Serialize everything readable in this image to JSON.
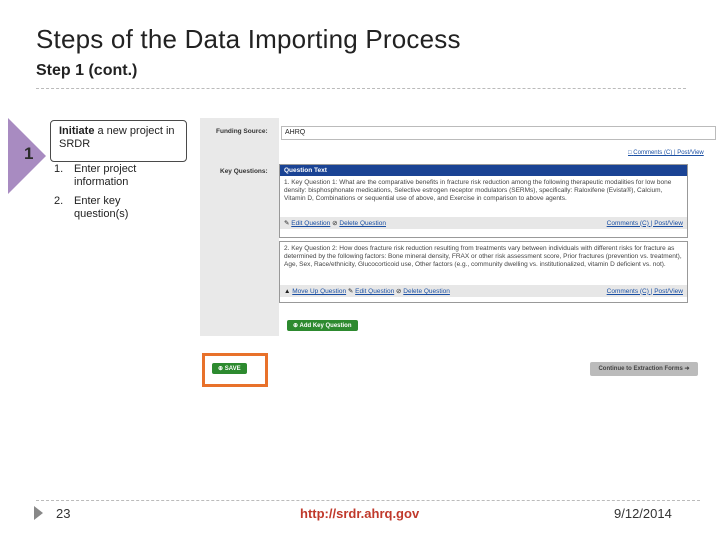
{
  "slide": {
    "title": "Steps of the Data Importing Process",
    "subtitle": "Step 1 (cont.)",
    "step_number": "1",
    "callout_bold": "Initiate",
    "callout_rest": " a new project in SRDR",
    "list": [
      {
        "num": "1.",
        "text": "Enter project information"
      },
      {
        "num": "2.",
        "text": "Enter key question(s)"
      }
    ]
  },
  "app": {
    "funding_label": "Funding Source:",
    "funding_value": "AHRQ",
    "comments_link": "Comments (C) | Post/View",
    "kq_label": "Key Questions:",
    "q1": {
      "header": "Question Text",
      "text": "1. Key Question 1: What are the comparative benefits in fracture risk reduction among the following therapeutic modalities for low bone density: bisphosphonate medications, Selective estrogen receptor modulators (SERMs), specifically: Raloxifene (Evista®), Calcium, Vitamin D, Combinations or sequential use of above, and Exercise in comparison to above agents.",
      "edit": "Edit Question",
      "delete": "Delete Question",
      "comments": "Comments (C) | Post/View"
    },
    "q2": {
      "text": "2. Key Question 2: How does fracture risk reduction resulting from treatments vary between individuals with different risks for fracture as determined by the following factors: Bone mineral density, FRAX or other risk assessment score, Prior fractures (prevention vs. treatment), Age, Sex, Race/ethnicity, Glucocorticoid use, Other factors (e.g., community dwelling vs. institutionalized, vitamin D deficient vs. not).",
      "move_up": "Move Up Question",
      "edit": "Edit Question",
      "delete": "Delete Question",
      "comments": "Comments (C) | Post/View"
    },
    "add_kq": "Add Key Question",
    "save": "SAVE",
    "continue": "Continue to Extraction Forms"
  },
  "footer": {
    "page": "23",
    "url": "http://srdr.ahrq.gov",
    "date": "9/12/2014"
  },
  "colors": {
    "accent_purple": "#a88bc1",
    "header_blue": "#1a4394",
    "button_green": "#2d8a2f",
    "highlight_orange": "#e8712a",
    "url_red": "#c0392b"
  }
}
